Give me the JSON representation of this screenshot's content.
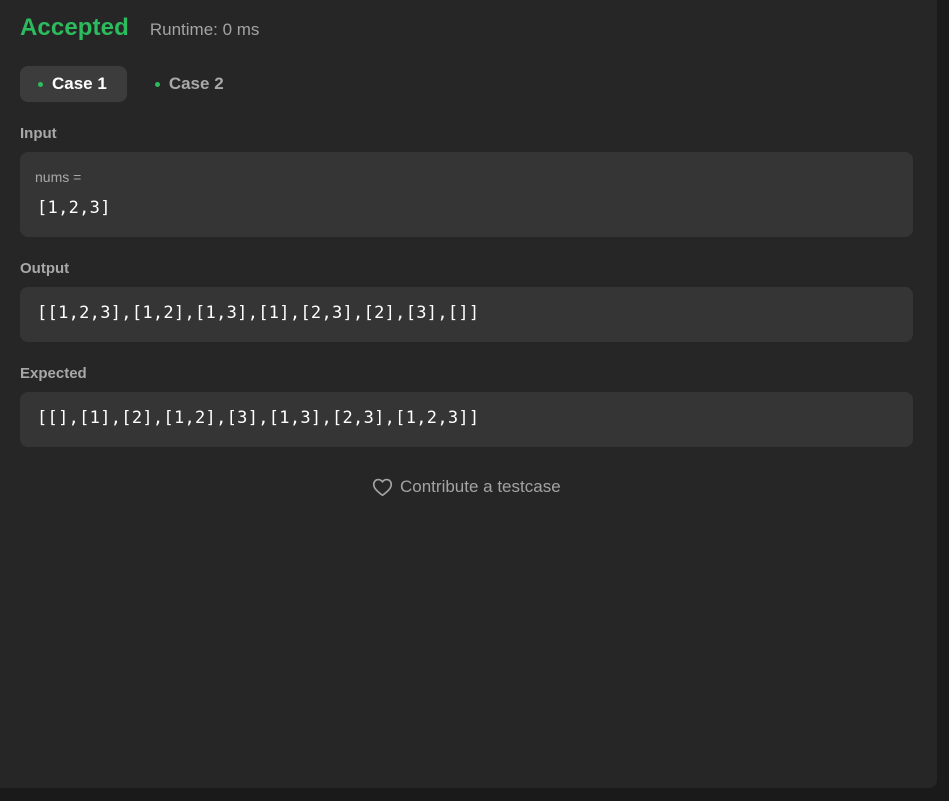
{
  "header": {
    "status": "Accepted",
    "runtime": "Runtime: 0 ms"
  },
  "tabs": [
    {
      "label": "Case 1",
      "active": true
    },
    {
      "label": "Case 2",
      "active": false
    }
  ],
  "input": {
    "label": "Input",
    "var_name": "nums =",
    "value": "[1,2,3]"
  },
  "output": {
    "label": "Output",
    "value": "[[1,2,3],[1,2],[1,3],[1],[2,3],[2],[3],[]]"
  },
  "expected": {
    "label": "Expected",
    "value": "[[],[1],[2],[1,2],[3],[1,3],[2,3],[1,2,3]]"
  },
  "contribute": {
    "label": "Contribute a testcase",
    "icon": "heart-icon"
  },
  "colors": {
    "accepted": "#2cbb5d",
    "panel_bg": "#262626",
    "box_bg": "#353535"
  }
}
